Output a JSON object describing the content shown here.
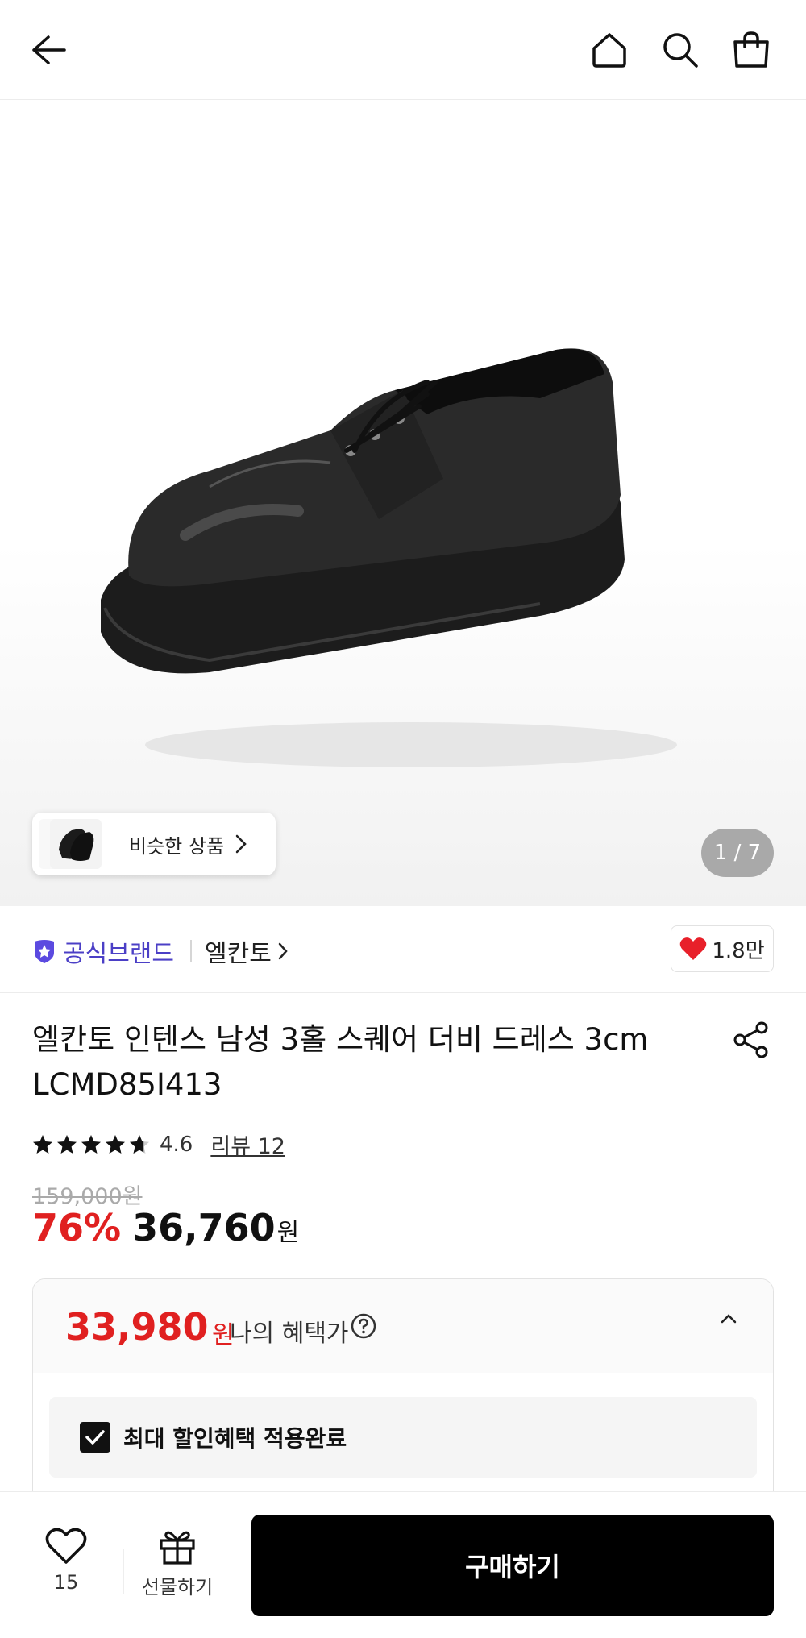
{
  "header": {
    "back_icon": "arrow-left-icon",
    "icons": [
      "home-icon",
      "search-icon",
      "shopping-bag-icon"
    ]
  },
  "hero": {
    "similar_label": "비슷한 상품",
    "counter": "1 / 7"
  },
  "brand": {
    "official_label": "공식브랜드",
    "brand_name": "엘칸토",
    "like_count": "1.8만",
    "accent": "#4b3fc6"
  },
  "product": {
    "title": "엘칸토 인텐스 남성 3홀 스퀘어 더비 드레스 3cm LCMD85I413",
    "rating": "4.6",
    "rating_value": 4.6,
    "review_label": "리뷰 12",
    "original_price": "159,000원",
    "discount": "76%",
    "price": "36,760",
    "price_unit": "원",
    "sale_color": "#e02020"
  },
  "benefit": {
    "price": "33,980",
    "price_unit": "원",
    "label": "나의 혜택가",
    "checkbox_label": "최대 할인혜택 적용완료"
  },
  "bottom": {
    "wish_count": "15",
    "gift_label": "선물하기",
    "buy_label": "구매하기"
  }
}
